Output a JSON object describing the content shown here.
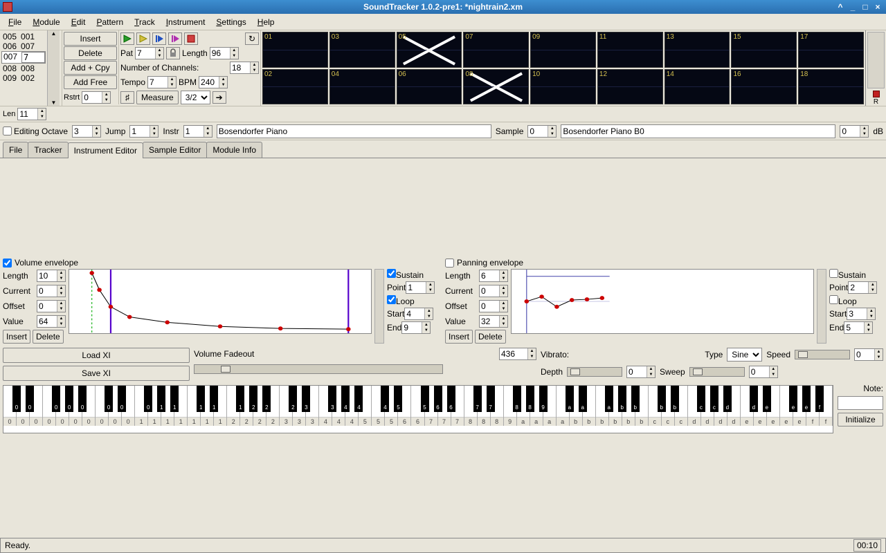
{
  "window": {
    "title": "SoundTracker 1.0.2-pre1: *nightrain2.xm"
  },
  "menu": [
    "File",
    "Module",
    "Edit",
    "Pattern",
    "Track",
    "Instrument",
    "Settings",
    "Help"
  ],
  "order": {
    "rows_before": [
      [
        "005",
        "001"
      ],
      [
        "006",
        "007"
      ]
    ],
    "sel_idx": "007",
    "sel_pat": "7",
    "rows_after": [
      [
        "008",
        "008"
      ],
      [
        "009",
        "002"
      ]
    ],
    "len_label": "Len",
    "len": "11",
    "rstrt_label": "Rstrt",
    "rstrt": "0"
  },
  "order_btns": {
    "insert": "Insert",
    "delete": "Delete",
    "addcpy": "Add + Cpy",
    "addfree": "Add Free"
  },
  "params": {
    "pat_label": "Pat",
    "pat": "7",
    "length_label": "Length",
    "length": "96",
    "chan_label": "Number of Channels:",
    "chan": "18",
    "tempo_label": "Tempo",
    "tempo": "7",
    "bpm_label": "BPM",
    "bpm": "240",
    "sharp": "♯",
    "measure_label": "Measure",
    "measure": "3/2"
  },
  "scopes": {
    "row1": [
      "01",
      "03",
      "05",
      "07",
      "09",
      "11",
      "13",
      "15",
      "17"
    ],
    "row2": [
      "02",
      "04",
      "06",
      "08",
      "10",
      "12",
      "14",
      "16",
      "18"
    ],
    "muted": [
      "05",
      "08"
    ]
  },
  "midrow": {
    "editing_octave_label": "Editing Octave",
    "editing_octave": "3",
    "jump_label": "Jump",
    "jump": "1",
    "instr_label": "Instr",
    "instr": "1",
    "instr_name": "Bosendorfer Piano",
    "sample_label": "Sample",
    "sample": "0",
    "sample_name": "Bosendorfer Piano B0",
    "db": "0",
    "db_label": "dB"
  },
  "tabs": [
    "File",
    "Tracker",
    "Instrument Editor",
    "Sample Editor",
    "Module Info"
  ],
  "active_tab": 2,
  "vol_env": {
    "title": "Volume envelope",
    "on": true,
    "length": "10",
    "current": "0",
    "offset": "0",
    "value": "64",
    "insert": "Insert",
    "delete": "Delete",
    "sustain": "Sustain",
    "sustain_on": true,
    "point": "1",
    "loop": "Loop",
    "loop_on": true,
    "start": "4",
    "end": "9"
  },
  "pan_env": {
    "title": "Panning envelope",
    "on": false,
    "length": "6",
    "current": "0",
    "offset": "0",
    "value": "32",
    "insert": "Insert",
    "delete": "Delete",
    "sustain": "Sustain",
    "sustain_on": false,
    "point": "2",
    "loop": "Loop",
    "loop_on": false,
    "start": "3",
    "end": "5"
  },
  "labels": {
    "length": "Length",
    "current": "Current",
    "offset": "Offset",
    "value": "Value",
    "point": "Point",
    "start": "Start",
    "end": "End"
  },
  "extras": {
    "load": "Load XI",
    "save": "Save XI",
    "fadeout_label": "Volume Fadeout",
    "fadeout": "436",
    "vibrato_label": "Vibrato:",
    "type_label": "Type",
    "type": "Sine",
    "speed_label": "Speed",
    "speed": "0",
    "depth_label": "Depth",
    "depth": "0",
    "sweep_label": "Sweep",
    "sweep": "0"
  },
  "keyboard": {
    "white_samples": [
      "0",
      "0",
      "0",
      "0",
      "0",
      "0",
      "0",
      "0",
      "0",
      "0",
      "1",
      "1",
      "1",
      "1",
      "1",
      "1",
      "1",
      "2",
      "2",
      "2",
      "2",
      "3",
      "3",
      "3",
      "4",
      "4",
      "4",
      "5",
      "5",
      "5",
      "6",
      "6",
      "7",
      "7",
      "7",
      "8",
      "8",
      "8",
      "9",
      "a",
      "a",
      "a",
      "a",
      "b",
      "b",
      "b",
      "b",
      "b",
      "b",
      "c",
      "c",
      "c",
      "d",
      "d",
      "d",
      "d",
      "e",
      "e",
      "e",
      "e",
      "e",
      "f",
      "f"
    ],
    "black_samples": [
      "0",
      "0",
      "0",
      "0",
      "0",
      "0",
      "0",
      "0",
      "1",
      "1",
      "1",
      "1",
      "1",
      "2",
      "2",
      "2",
      "3",
      "3",
      "4",
      "4",
      "4",
      "5",
      "5",
      "6",
      "6",
      "7",
      "7",
      "8",
      "8",
      "9",
      "a",
      "a",
      "a",
      "b",
      "b",
      "b",
      "b",
      "c",
      "c",
      "d",
      "d",
      "e",
      "e",
      "e",
      "f"
    ],
    "note_label": "Note:",
    "initialize": "Initialize"
  },
  "status": {
    "text": "Ready.",
    "time": "00:10"
  },
  "meter": {
    "R": "R"
  }
}
